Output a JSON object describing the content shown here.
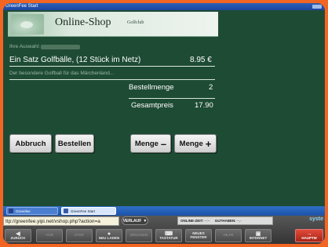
{
  "window": {
    "title": "GreenFee Start"
  },
  "shop": {
    "title": "Online-Shop",
    "subtitle": "Golfclub"
  },
  "order": {
    "selection_label": "Ihre Auswahl:",
    "product_name": "Ein Satz Golfbälle, (12 Stück im Netz)",
    "product_price": "8.95 €",
    "product_description": "Der besondere Golfball für das Märchenland...",
    "quantity_label": "Bestellmenge",
    "quantity_value": "2",
    "total_label": "Gesamtpreis",
    "total_value": "17.90"
  },
  "actions": {
    "cancel": "Abbruch",
    "order": "Bestellen",
    "qty_minus": "Menge",
    "qty_plus": "Menge"
  },
  "taskbar": {
    "items": [
      {
        "label": "Greenfee"
      },
      {
        "label": "GreenFee Start"
      }
    ]
  },
  "kiosk": {
    "url": "ttp://greenfee.yipi.net/vshop.php?action=a",
    "history_label": "VERLAUF",
    "online_label": "ONLINE-ZEIT:",
    "online_value": "--:--",
    "credit_label": "GUTHABEN:",
    "credit_value": "--,-",
    "brand": "syste",
    "nav": {
      "back": "ZURÜCK",
      "forward": "VOR",
      "stop": "STOP",
      "reload": "NEU LADEN",
      "print": "DRUCKEN",
      "keyboard": "TASTATUR",
      "new_window": "NEUES FENSTER",
      "help": "HILFE",
      "internet": "INTERNET",
      "home": "HAUPTM"
    }
  },
  "colors": {
    "frame": "#f26522",
    "background": "#1e4b34",
    "taskbar": "#2f6fc8"
  }
}
